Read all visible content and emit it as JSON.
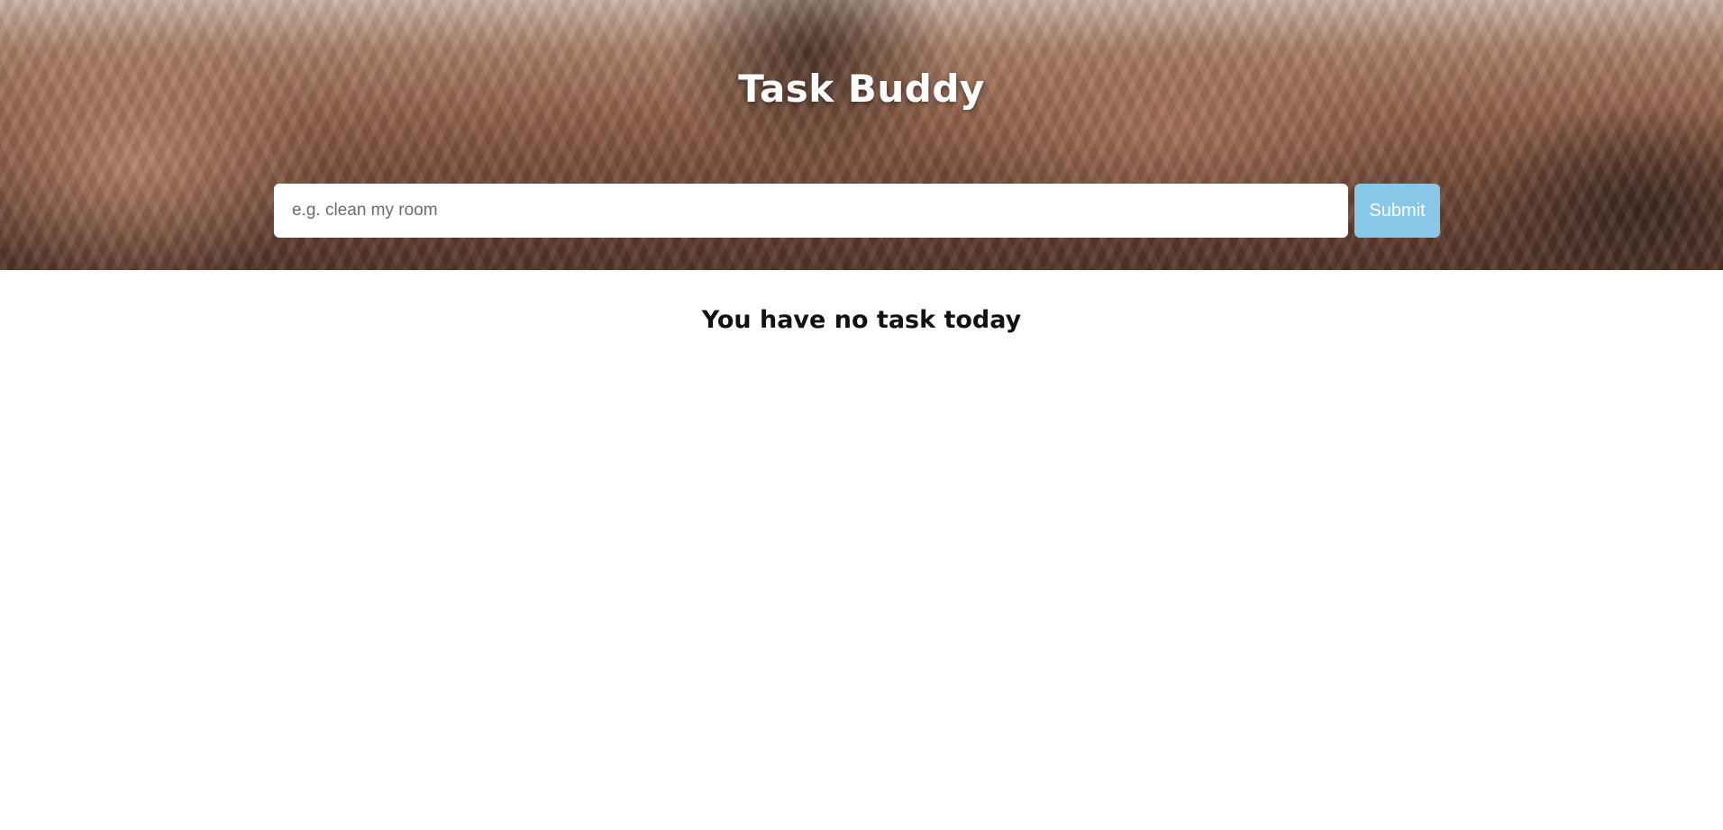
{
  "app": {
    "title": "Task Buddy"
  },
  "form": {
    "placeholder": "e.g. clean my room",
    "value": "",
    "submit_label": "Submit"
  },
  "tasks": {
    "empty_message": "You have no task today",
    "items": []
  },
  "colors": {
    "submit_button": "#87c8e8",
    "background": "#ffffff",
    "title_text": "#ffffff"
  }
}
